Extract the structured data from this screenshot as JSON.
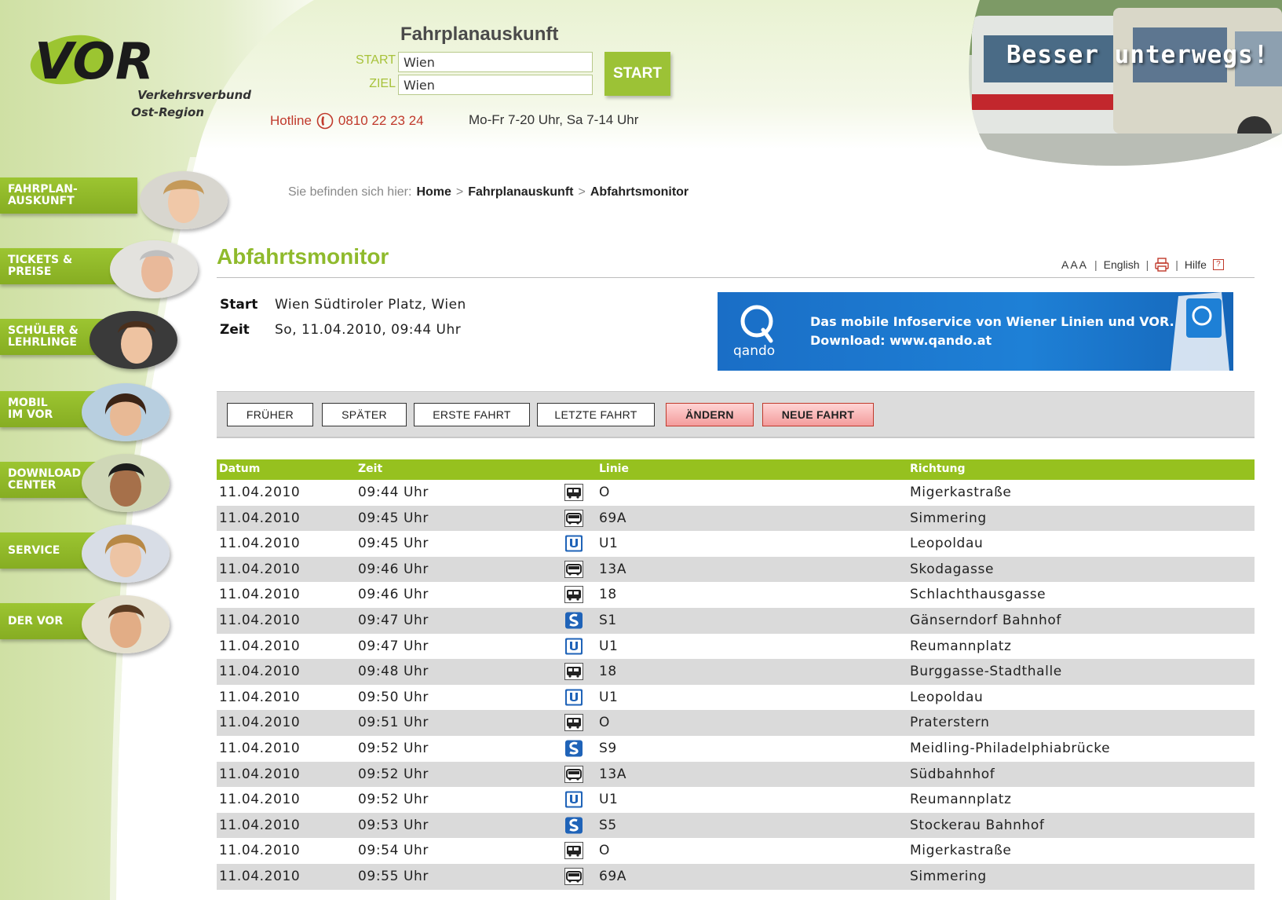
{
  "header": {
    "logo_text": "VOR",
    "logo_tagline_1": "Verkehrsverbund",
    "logo_tagline_2": "Ost-Region",
    "fahrplan_title": "Fahrplanauskunft",
    "start_label": "START",
    "start_value": "Wien",
    "ziel_label": "ZIEL",
    "ziel_value": "Wien",
    "start_button": "START",
    "hotline_label": "Hotline",
    "hotline_number": "0810 22 23 24",
    "hotline_hours": "Mo-Fr 7-20 Uhr, Sa 7-14 Uhr",
    "banner_text": "Besser unterwegs!"
  },
  "sidebar": {
    "items": [
      {
        "line1": "FAHRPLAN-",
        "line2": "AUSKUNFT"
      },
      {
        "line1": "TICKETS &",
        "line2": "PREISE"
      },
      {
        "line1": "SCHÜLER &",
        "line2": "LEHRLINGE"
      },
      {
        "line1": "MOBIL",
        "line2": "IM VOR"
      },
      {
        "line1": "DOWNLOAD",
        "line2": "CENTER"
      },
      {
        "line1": "SERVICE",
        "line2": ""
      },
      {
        "line1": "DER VOR",
        "line2": ""
      }
    ]
  },
  "breadcrumb": {
    "prefix": "Sie befinden sich hier:",
    "items": [
      "Home",
      "Fahrplanauskunft",
      "Abfahrtsmonitor"
    ],
    "separator": ">"
  },
  "main": {
    "title": "Abfahrtsmonitor",
    "tools": {
      "font_size": "AAA",
      "english": "English",
      "help": "Hilfe",
      "help_icon": "?"
    },
    "start_key": "Start",
    "start_val": "Wien Südtiroler Platz, Wien",
    "zeit_key": "Zeit",
    "zeit_val": "So, 11.04.2010, 09:44 Uhr",
    "qando": {
      "logo_text": "qando",
      "line1": "Das mobile Infoservice von Wiener Linien und VOR.",
      "line2": "Download: www.qando.at"
    },
    "buttons": {
      "frueher": "FRÜHER",
      "spaeter": "SPÄTER",
      "erste": "ERSTE FAHRT",
      "letzte": "LETZTE FAHRT",
      "aendern": "ÄNDERN",
      "neue": "NEUE FAHRT"
    },
    "table": {
      "headers": {
        "datum": "Datum",
        "zeit": "Zeit",
        "linie": "Linie",
        "richtung": "Richtung"
      },
      "rows": [
        {
          "datum": "11.04.2010",
          "zeit": "09:44 Uhr",
          "type": "tram",
          "linie": "O",
          "richtung": "Migerkastraße"
        },
        {
          "datum": "11.04.2010",
          "zeit": "09:45 Uhr",
          "type": "bus",
          "linie": "69A",
          "richtung": "Simmering"
        },
        {
          "datum": "11.04.2010",
          "zeit": "09:45 Uhr",
          "type": "ubahn",
          "linie": "U1",
          "richtung": "Leopoldau"
        },
        {
          "datum": "11.04.2010",
          "zeit": "09:46 Uhr",
          "type": "bus",
          "linie": "13A",
          "richtung": "Skodagasse"
        },
        {
          "datum": "11.04.2010",
          "zeit": "09:46 Uhr",
          "type": "tram",
          "linie": "18",
          "richtung": "Schlachthausgasse"
        },
        {
          "datum": "11.04.2010",
          "zeit": "09:47 Uhr",
          "type": "sbahn",
          "linie": "S1",
          "richtung": "Gänserndorf Bahnhof"
        },
        {
          "datum": "11.04.2010",
          "zeit": "09:47 Uhr",
          "type": "ubahn",
          "linie": "U1",
          "richtung": "Reumannplatz"
        },
        {
          "datum": "11.04.2010",
          "zeit": "09:48 Uhr",
          "type": "tram",
          "linie": "18",
          "richtung": "Burggasse-Stadthalle"
        },
        {
          "datum": "11.04.2010",
          "zeit": "09:50 Uhr",
          "type": "ubahn",
          "linie": "U1",
          "richtung": "Leopoldau"
        },
        {
          "datum": "11.04.2010",
          "zeit": "09:51 Uhr",
          "type": "tram",
          "linie": "O",
          "richtung": "Praterstern"
        },
        {
          "datum": "11.04.2010",
          "zeit": "09:52 Uhr",
          "type": "sbahn",
          "linie": "S9",
          "richtung": "Meidling-Philadelphiabrücke"
        },
        {
          "datum": "11.04.2010",
          "zeit": "09:52 Uhr",
          "type": "bus",
          "linie": "13A",
          "richtung": "Südbahnhof"
        },
        {
          "datum": "11.04.2010",
          "zeit": "09:52 Uhr",
          "type": "ubahn",
          "linie": "U1",
          "richtung": "Reumannplatz"
        },
        {
          "datum": "11.04.2010",
          "zeit": "09:53 Uhr",
          "type": "sbahn",
          "linie": "S5",
          "richtung": "Stockerau Bahnhof"
        },
        {
          "datum": "11.04.2010",
          "zeit": "09:54 Uhr",
          "type": "tram",
          "linie": "O",
          "richtung": "Migerkastraße"
        },
        {
          "datum": "11.04.2010",
          "zeit": "09:55 Uhr",
          "type": "bus",
          "linie": "69A",
          "richtung": "Simmering"
        }
      ]
    }
  },
  "colors": {
    "brand_green": "#96c11f",
    "title_green": "#8fba2c",
    "label_green": "#a7c23a",
    "hotline_red": "#c0392b",
    "qando_blue": "#1e80d6"
  }
}
